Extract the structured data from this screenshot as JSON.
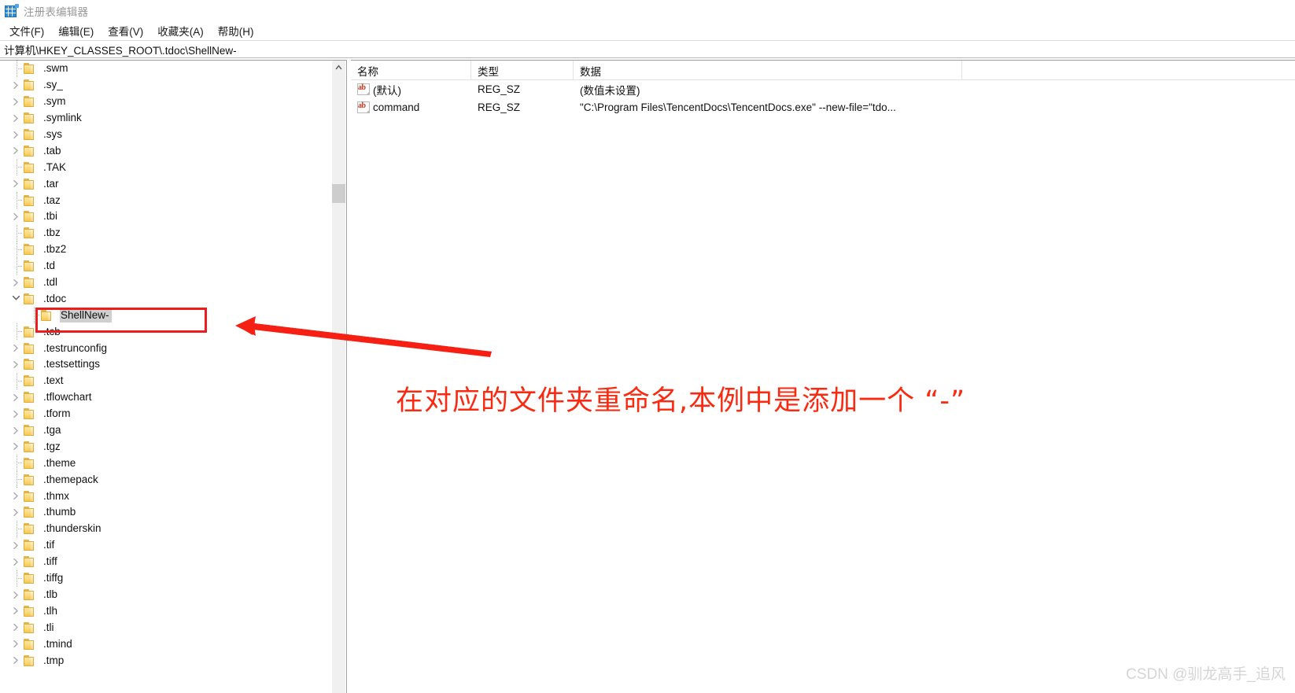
{
  "window": {
    "title": "注册表编辑器",
    "icon": "registry-icon"
  },
  "menu": [
    {
      "label": "文件(F)"
    },
    {
      "label": "编辑(E)"
    },
    {
      "label": "查看(V)"
    },
    {
      "label": "收藏夹(A)"
    },
    {
      "label": "帮助(H)"
    }
  ],
  "address": {
    "path": "计算机\\HKEY_CLASSES_ROOT\\.tdoc\\ShellNew-"
  },
  "tree": {
    "items": [
      {
        "label": ".swm",
        "indent": 1,
        "expander": "none",
        "selected": false
      },
      {
        "label": ".sy_",
        "indent": 1,
        "expander": "collapsed",
        "selected": false
      },
      {
        "label": ".sym",
        "indent": 1,
        "expander": "collapsed",
        "selected": false
      },
      {
        "label": ".symlink",
        "indent": 1,
        "expander": "collapsed",
        "selected": false
      },
      {
        "label": ".sys",
        "indent": 1,
        "expander": "collapsed",
        "selected": false
      },
      {
        "label": ".tab",
        "indent": 1,
        "expander": "collapsed",
        "selected": false
      },
      {
        "label": ".TAK",
        "indent": 1,
        "expander": "none",
        "selected": false
      },
      {
        "label": ".tar",
        "indent": 1,
        "expander": "collapsed",
        "selected": false
      },
      {
        "label": ".taz",
        "indent": 1,
        "expander": "none",
        "selected": false
      },
      {
        "label": ".tbi",
        "indent": 1,
        "expander": "collapsed",
        "selected": false
      },
      {
        "label": ".tbz",
        "indent": 1,
        "expander": "none",
        "selected": false
      },
      {
        "label": ".tbz2",
        "indent": 1,
        "expander": "none",
        "selected": false
      },
      {
        "label": ".td",
        "indent": 1,
        "expander": "none",
        "selected": false
      },
      {
        "label": ".tdl",
        "indent": 1,
        "expander": "collapsed",
        "selected": false
      },
      {
        "label": ".tdoc",
        "indent": 1,
        "expander": "expanded",
        "selected": false
      },
      {
        "label": "ShellNew-",
        "indent": 2,
        "expander": "none",
        "selected": true
      },
      {
        "label": ".tcb",
        "indent": 1,
        "expander": "none",
        "selected": false
      },
      {
        "label": ".testrunconfig",
        "indent": 1,
        "expander": "collapsed",
        "selected": false
      },
      {
        "label": ".testsettings",
        "indent": 1,
        "expander": "collapsed",
        "selected": false
      },
      {
        "label": ".text",
        "indent": 1,
        "expander": "none",
        "selected": false
      },
      {
        "label": ".tflowchart",
        "indent": 1,
        "expander": "collapsed",
        "selected": false
      },
      {
        "label": ".tform",
        "indent": 1,
        "expander": "collapsed",
        "selected": false
      },
      {
        "label": ".tga",
        "indent": 1,
        "expander": "collapsed",
        "selected": false
      },
      {
        "label": ".tgz",
        "indent": 1,
        "expander": "collapsed",
        "selected": false
      },
      {
        "label": ".theme",
        "indent": 1,
        "expander": "none",
        "selected": false
      },
      {
        "label": ".themepack",
        "indent": 1,
        "expander": "none",
        "selected": false
      },
      {
        "label": ".thmx",
        "indent": 1,
        "expander": "collapsed",
        "selected": false
      },
      {
        "label": ".thumb",
        "indent": 1,
        "expander": "collapsed",
        "selected": false
      },
      {
        "label": ".thunderskin",
        "indent": 1,
        "expander": "none",
        "selected": false
      },
      {
        "label": ".tif",
        "indent": 1,
        "expander": "collapsed",
        "selected": false
      },
      {
        "label": ".tiff",
        "indent": 1,
        "expander": "collapsed",
        "selected": false
      },
      {
        "label": ".tiffg",
        "indent": 1,
        "expander": "none",
        "selected": false
      },
      {
        "label": ".tlb",
        "indent": 1,
        "expander": "collapsed",
        "selected": false
      },
      {
        "label": ".tlh",
        "indent": 1,
        "expander": "collapsed",
        "selected": false
      },
      {
        "label": ".tli",
        "indent": 1,
        "expander": "collapsed",
        "selected": false
      },
      {
        "label": ".tmind",
        "indent": 1,
        "expander": "collapsed",
        "selected": false
      },
      {
        "label": ".tmp",
        "indent": 1,
        "expander": "collapsed",
        "selected": false
      }
    ]
  },
  "list": {
    "columns": [
      {
        "label": "名称"
      },
      {
        "label": "类型"
      },
      {
        "label": "数据"
      }
    ],
    "rows": [
      {
        "icon": "string-value-icon",
        "name": "(默认)",
        "type": "REG_SZ",
        "data": "(数值未设置)"
      },
      {
        "icon": "string-value-icon",
        "name": "command",
        "type": "REG_SZ",
        "data": "\"C:\\Program Files\\TencentDocs\\TencentDocs.exe\" --new-file=\"tdo..."
      }
    ]
  },
  "annotations": {
    "text": "在对应的文件夹重命名,本例中是添加一个 “-”",
    "color": "#fa2a11",
    "highlight_target": "ShellNew-"
  },
  "watermark": {
    "text": "CSDN @驯龙高手_追风"
  }
}
